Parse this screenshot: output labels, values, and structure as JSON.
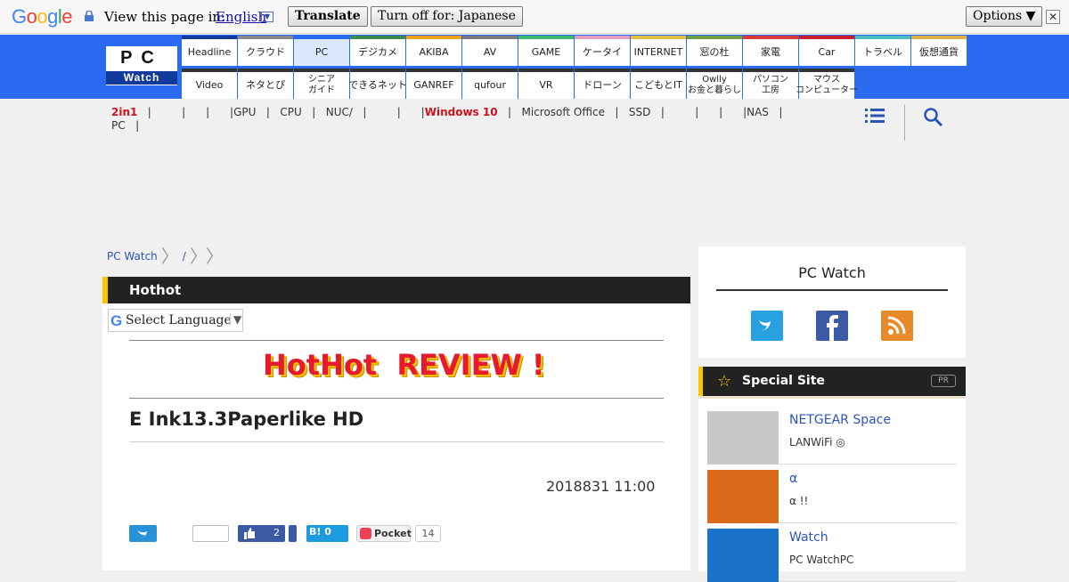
{
  "translate_bar": {
    "logo": "Google",
    "view_text": "View this page in:",
    "language": "English",
    "translate_button": "Translate",
    "turn_off_button": "Turn off for: Japanese",
    "options_button": "Options ▼",
    "close": "✕"
  },
  "site": {
    "logo_top": "PC",
    "logo_bottom": "Watch",
    "nav_row1": [
      "Headline",
      "クラウド",
      "PC",
      "デジカメ",
      "AKIBA",
      "AV",
      "GAME",
      "ケータイ",
      "INTERNET",
      "窓の杜",
      "家電",
      "Car",
      "トラベル",
      "仮想通貨"
    ],
    "nav_row1_colors": [
      "#123a9c",
      "#888888",
      "#2a6bf2",
      "#3b8a4a",
      "#f0a020",
      "#7a7a7a",
      "#3cb86a",
      "#e0a0c0",
      "#e0c040",
      "#70a040",
      "#d43a3a",
      "#c8202a",
      "#48c0c0",
      "#e0b040"
    ],
    "nav_row2": [
      "Video",
      "ネタとぴ",
      "シニア\nガイド",
      "できるネット",
      "GANREF",
      "qufour",
      "VR",
      "ドローン",
      "こどもとIT",
      "Owlly\nお金と暮らし",
      "パソコン\n工房",
      "マウス\nコンピューター"
    ],
    "subnav": [
      "2in1",
      "",
      "",
      "",
      "GPU",
      "CPU",
      "NUC/",
      "",
      "",
      "Windows 10",
      "Microsoft Office",
      "SSD",
      "",
      "",
      "",
      "NAS",
      "PC"
    ]
  },
  "breadcrumb": [
    "PC Watch",
    "/"
  ],
  "section": {
    "label": "Hothot",
    "select_language": "Select Language",
    "banner": "HotHot  REVIEW !",
    "article_title": "E Ink13.3Paperlike HD",
    "date": "2018831 11:00"
  },
  "social": {
    "fb_count": "2",
    "hatena": "B! 0",
    "pocket": "Pocket",
    "pocket_count": "14"
  },
  "sidebar": {
    "brand": "PC Watch",
    "special_title": "Special Site",
    "pr": "PR",
    "items": [
      {
        "name": "NETGEAR Space",
        "desc": "LANWiFi ◎",
        "thumb_color": "#c8c8c8"
      },
      {
        "name": "α",
        "desc": "α !!",
        "thumb_color": "#d86a1a"
      },
      {
        "name": "Watch",
        "desc": "PC WatchPC",
        "thumb_color": "#1a73c9"
      }
    ]
  }
}
